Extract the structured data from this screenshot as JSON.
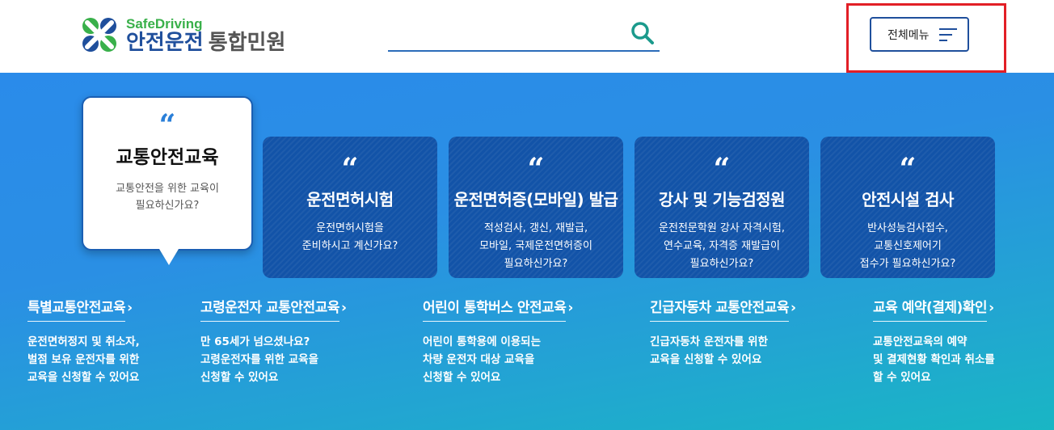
{
  "header": {
    "logo_en": "SafeDriving",
    "logo_ko_main": "안전운전",
    "logo_ko_sub": "통합민원",
    "search": {
      "placeholder": "",
      "value": "",
      "icon": "search-icon"
    },
    "menu_button_label": "전체메뉴",
    "menu_icon": "hamburger-icon"
  },
  "colors": {
    "brand_blue": "#1f4f9c",
    "brand_green": "#39b04a",
    "highlight_red": "#e21f26"
  },
  "active_card": {
    "quote": "“",
    "title": "교통안전교육",
    "desc_line1": "교통안전을 위한 교육이",
    "desc_line2": "필요하신가요?"
  },
  "cards": [
    {
      "quote": "“",
      "title": "운전면허시험",
      "lines": [
        "운전면허시험을",
        "준비하시고 계신가요?"
      ]
    },
    {
      "quote": "“",
      "title": "운전면허증(모바일) 발급",
      "lines": [
        "적성검사, 갱신, 재발급,",
        "모바일, 국제운전면허증이",
        "필요하신가요?"
      ]
    },
    {
      "quote": "“",
      "title": "강사 및 기능검정원",
      "lines": [
        "운전전문학원 강사 자격시험,",
        "연수교육, 자격증 재발급이",
        "필요하신가요?"
      ]
    },
    {
      "quote": "“",
      "title": "안전시설 검사",
      "lines": [
        "반사성능검사접수,",
        "교통신호제어기",
        "접수가 필요하신가요?"
      ]
    }
  ],
  "links": [
    {
      "title": "특별교통안전교육",
      "chevron": "›",
      "lines": [
        "운전면허정지 및 취소자,",
        "벌점 보유 운전자를 위한",
        "교육을 신청할 수 있어요"
      ]
    },
    {
      "title": "고령운전자 교통안전교육",
      "chevron": "›",
      "lines": [
        "만 65세가 넘으셨나요?",
        "고령운전자를 위한 교육을",
        "신청할 수 있어요"
      ]
    },
    {
      "title": "어린이 통학버스 안전교육",
      "chevron": "›",
      "lines": [
        "어린이 통학용에 이용되는",
        "차량 운전자 대상 교육을",
        "신청할 수 있어요"
      ]
    },
    {
      "title": "긴급자동차 교통안전교육",
      "chevron": "›",
      "lines": [
        "긴급자동차 운전자를 위한",
        "교육을 신청할 수 있어요"
      ]
    },
    {
      "title": "교육 예약(결제)확인",
      "chevron": "›",
      "lines": [
        "교통안전교육의 예약",
        "및 결제현황 확인과 취소를",
        "할 수 있어요"
      ]
    }
  ]
}
